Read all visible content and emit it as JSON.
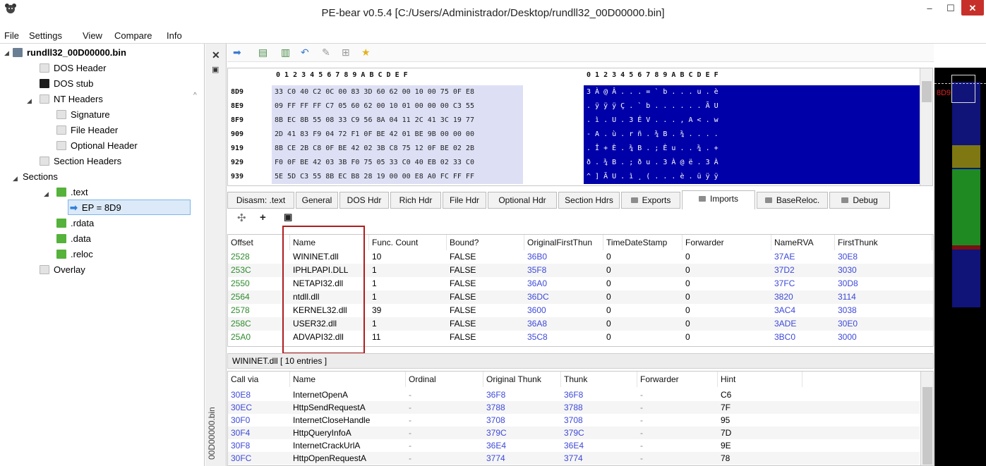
{
  "window": {
    "title": "PE-bear v0.5.4 [C:/Users/Administrador/Desktop/rundll32_00D00000.bin]",
    "minimize": "–",
    "maximize": "☐",
    "close": "✕"
  },
  "menu": [
    "File",
    "Settings",
    "View",
    "Compare",
    "Info"
  ],
  "tree": {
    "root": "rundll32_00D00000.bin",
    "items": {
      "dos_header": "DOS Header",
      "dos_stub": "DOS stub",
      "nt_headers": "NT Headers",
      "signature": "Signature",
      "file_header": "File Header",
      "optional_header": "Optional Header",
      "section_headers": "Section Headers",
      "sections": "Sections",
      "text": ".text",
      "ep": "EP = 8D9",
      "rdata": ".rdata",
      "data": ".data",
      "reloc": ".reloc",
      "overlay": "Overlay"
    }
  },
  "side_label": "00D00000.bin",
  "hex": {
    "header": "0 1 2 3 4 5 6 7 8 9 A B C D E F",
    "ascii_header": "0 1 2 3 4 5 6 7 8 9 A B C D E F",
    "rows": [
      {
        "offset": "8D9",
        "bytes": "33 C0 40 C2 0C 00 83 3D 60 62 00 10 00 75 0F E8",
        "ascii": "3 À @ Â . . . = ` b . . . u . è"
      },
      {
        "offset": "8E9",
        "bytes": "09 FF FF FF C7 05 60 62 00 10 01 00 00 00 C3 55",
        "ascii": ". ÿ ÿ ÿ Ç . ` b . . . . . . Ã U"
      },
      {
        "offset": "8F9",
        "bytes": "8B EC 8B 55 08 33 C9 56 8A 04 11 2C 41 3C 19 77",
        "ascii": ". ì . U . 3 É V . . . , A < . w"
      },
      {
        "offset": "909",
        "bytes": "2D 41 83 F9 04 72 F1 0F BE 42 01 BE 9B 00 00 00",
        "ascii": "- A . ù . r ñ . ¾ B . ¾ . . . ."
      },
      {
        "offset": "919",
        "bytes": "8B CE 2B C8 0F BE 42 02 3B C8 75 12 0F BE 02 2B",
        "ascii": ". Î + È . ¾ B . ; È u . . ¾ . +"
      },
      {
        "offset": "929",
        "bytes": "F0 0F BE 42 03 3B F0 75 05 33 C0 40 EB 02 33 C0",
        "ascii": "ð . ¾ B . ; ð u . 3 À @ ë . 3 À"
      },
      {
        "offset": "939",
        "bytes": "5E 5D C3 55 8B EC B8 28 19 00 00 E8 A0 FC FF FF",
        "ascii": "^ ] Ã U . ì ¸ ( . . . è . ü ÿ ÿ"
      }
    ]
  },
  "minimap": {
    "label": "8D9"
  },
  "tabs": [
    "Disasm: .text",
    "General",
    "DOS Hdr",
    "Rich Hdr",
    "File Hdr",
    "Optional Hdr",
    "Section Hdrs",
    "Exports",
    "Imports",
    "BaseReloc.",
    "Debug"
  ],
  "active_tab": "Imports",
  "imports": {
    "columns": [
      "Offset",
      "Name",
      "Func. Count",
      "Bound?",
      "OriginalFirstThun",
      "TimeDateStamp",
      "Forwarder",
      "NameRVA",
      "FirstThunk"
    ],
    "rows": [
      [
        "2528",
        "WININET.dll",
        "10",
        "FALSE",
        "36B0",
        "0",
        "0",
        "37AE",
        "30E8"
      ],
      [
        "253C",
        "IPHLPAPI.DLL",
        "1",
        "FALSE",
        "35F8",
        "0",
        "0",
        "37D2",
        "3030"
      ],
      [
        "2550",
        "NETAPI32.dll",
        "1",
        "FALSE",
        "36A0",
        "0",
        "0",
        "37FC",
        "30D8"
      ],
      [
        "2564",
        "ntdll.dll",
        "1",
        "FALSE",
        "36DC",
        "0",
        "0",
        "3820",
        "3114"
      ],
      [
        "2578",
        "KERNEL32.dll",
        "39",
        "FALSE",
        "3600",
        "0",
        "0",
        "3AC4",
        "3038"
      ],
      [
        "258C",
        "USER32.dll",
        "1",
        "FALSE",
        "36A8",
        "0",
        "0",
        "3ADE",
        "30E0"
      ],
      [
        "25A0",
        "ADVAPI32.dll",
        "11",
        "FALSE",
        "35C8",
        "0",
        "0",
        "3BC0",
        "3000"
      ]
    ]
  },
  "sub_label": "WININET.dll   [ 10 entries ]",
  "functions": {
    "columns": [
      "Call via",
      "Name",
      "Ordinal",
      "Original Thunk",
      "Thunk",
      "Forwarder",
      "Hint"
    ],
    "rows": [
      [
        "30E8",
        "InternetOpenA",
        "-",
        "36F8",
        "36F8",
        "-",
        "C6"
      ],
      [
        "30EC",
        "HttpSendRequestA",
        "-",
        "3788",
        "3788",
        "-",
        "7F"
      ],
      [
        "30F0",
        "InternetCloseHandle",
        "-",
        "3708",
        "3708",
        "-",
        "95"
      ],
      [
        "30F4",
        "HttpQueryInfoA",
        "-",
        "379C",
        "379C",
        "-",
        "7D"
      ],
      [
        "30F8",
        "InternetCrackUrlA",
        "-",
        "36E4",
        "36E4",
        "-",
        "9E"
      ],
      [
        "30FC",
        "HttpOpenRequestA",
        "-",
        "3774",
        "3774",
        "-",
        "78"
      ]
    ]
  }
}
